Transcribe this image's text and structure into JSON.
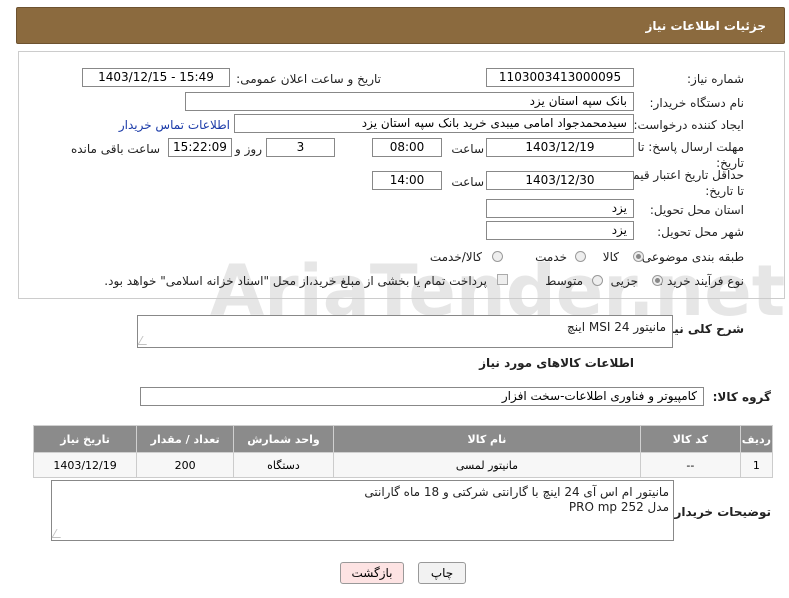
{
  "header": {
    "title": "جزئیات اطلاعات نیاز"
  },
  "watermark": {
    "text": "AriaTender.net"
  },
  "fields": {
    "need_number_label": "شماره نیاز:",
    "need_number": "1103003413000095",
    "announce_label": "تاریخ و ساعت اعلان عمومی:",
    "announce_value": "1403/12/15 - 15:49",
    "buyer_org_label": "نام دستگاه خریدار:",
    "buyer_org": "بانک سپه استان یزد",
    "requester_label": "ایجاد کننده درخواست:",
    "requester": "سیدمحمدجواد امامی میبدی خرید   بانک سپه استان یزد",
    "contact_link": "اطلاعات تماس خریدار",
    "reply_deadline_label": "مهلت ارسال پاسخ: تا تاریخ:",
    "reply_date": "1403/12/19",
    "hour_label": "ساعت",
    "reply_time": "08:00",
    "days": "3",
    "days_label": "روز و",
    "remaining_time": "15:22:09",
    "remaining_label": "ساعت باقی مانده",
    "price_validity_label": "حداقل تاریخ اعتبار قیمت: تا تاریخ:",
    "price_date": "1403/12/30",
    "price_time": "14:00",
    "province_label": "استان محل تحویل:",
    "province": "یزد",
    "city_label": "شهر محل تحویل:",
    "city": "یزد",
    "category_label": "طبقه بندی موضوعی:",
    "category_options": [
      "کالا",
      "خدمت",
      "کالا/خدمت"
    ],
    "category_selected": "کالا",
    "process_label": "نوع فرآیند خرید :",
    "process_options": [
      "جزیی",
      "متوسط"
    ],
    "process_selected": "جزیی",
    "payment_note": "پرداخت تمام یا بخشی از مبلغ خرید،از محل \"اسناد خزانه اسلامی\" خواهد بود."
  },
  "description": {
    "label": "شرح کلی نیاز:",
    "value": "مانیتور  24   MSI    اینچ"
  },
  "goods": {
    "section_title": "اطلاعات کالاهای مورد نیاز",
    "group_label": "گروه کالا:",
    "group_value": "کامپیوتر و فناوری اطلاعات-سخت افزار",
    "columns": [
      "ردیف",
      "کد کالا",
      "نام کالا",
      "واحد شمارش",
      "تعداد / مقدار",
      "تاریخ نیاز"
    ],
    "rows": [
      {
        "row": "1",
        "code": "--",
        "name": "مانیتور لمسی",
        "unit": "دستگاه",
        "qty": "200",
        "date": "1403/12/19"
      }
    ]
  },
  "buyer_notes": {
    "label": "توضیحات خریدار:",
    "line1": "مانیتور ام اس آی 24 اینچ با گارانتی شرکتی و 18 ماه گارانتی",
    "line2": "مدل PRO mp 252"
  },
  "buttons": {
    "print": "چاپ",
    "back": "بازگشت"
  }
}
